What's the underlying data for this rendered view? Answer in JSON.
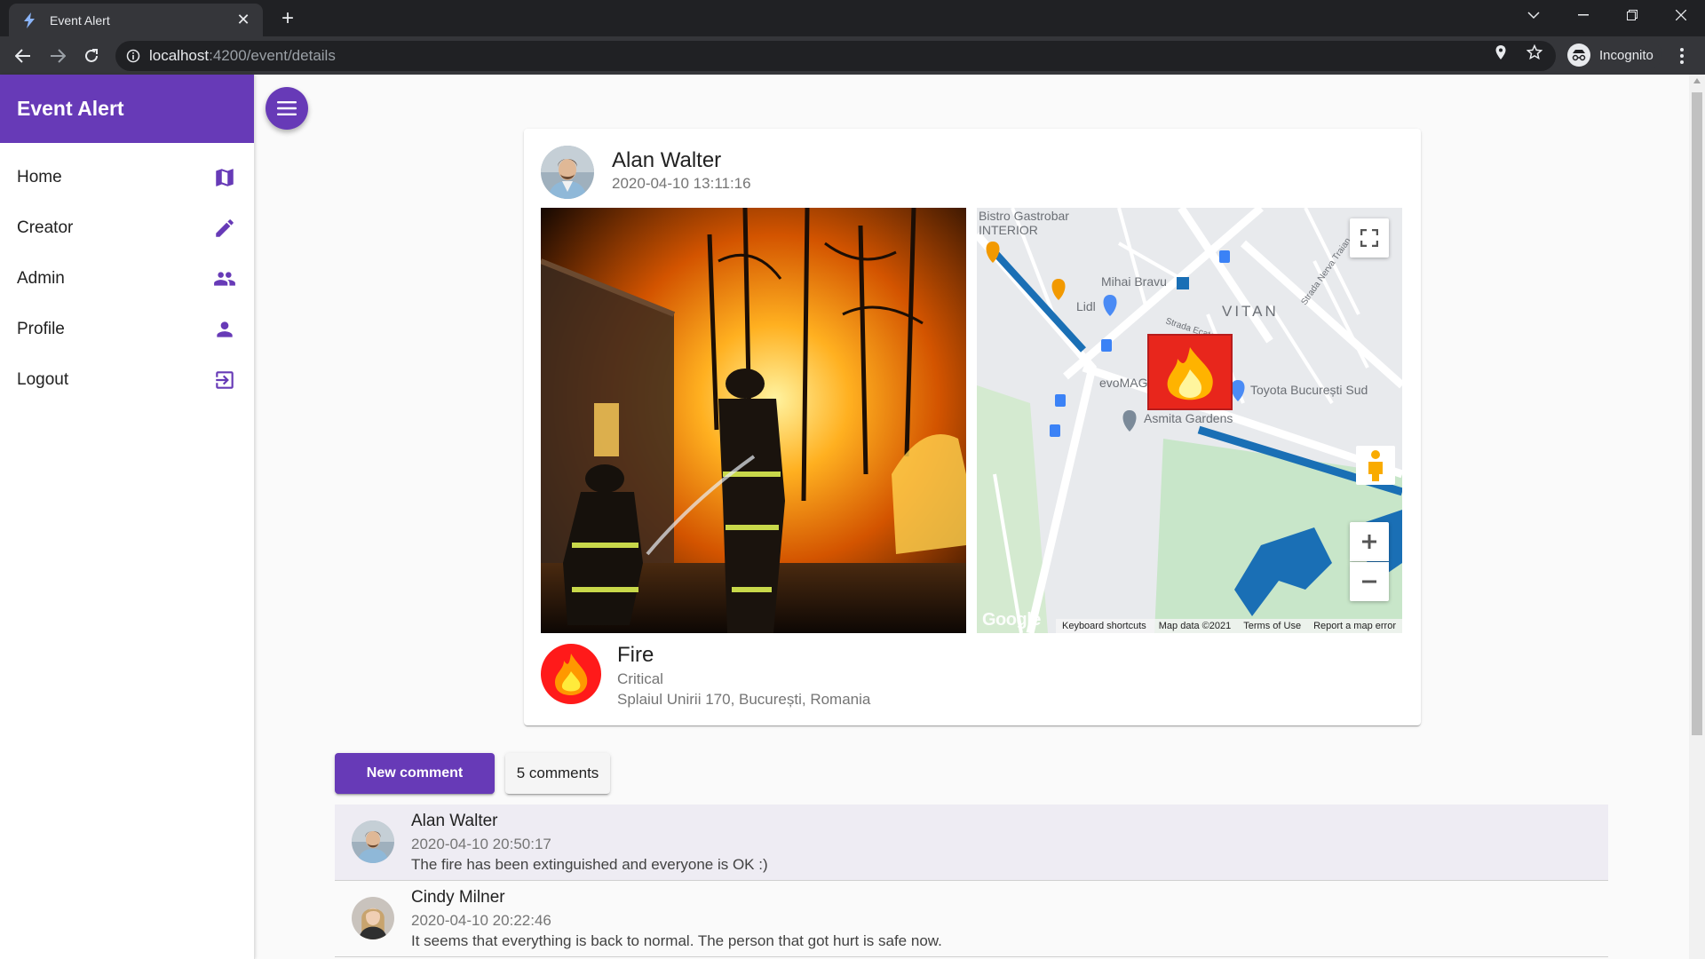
{
  "browser": {
    "tab_title": "Event Alert",
    "url_host": "localhost",
    "url_path": ":4200/event/details",
    "profile_label": "Incognito"
  },
  "sidebar": {
    "title": "Event Alert",
    "items": [
      {
        "label": "Home",
        "icon": "map-icon"
      },
      {
        "label": "Creator",
        "icon": "pencil-icon"
      },
      {
        "label": "Admin",
        "icon": "group-icon"
      },
      {
        "label": "Profile",
        "icon": "person-icon"
      },
      {
        "label": "Logout",
        "icon": "logout-icon"
      }
    ]
  },
  "event": {
    "author": "Alan Walter",
    "posted_at": "2020-04-10 13:11:16",
    "type": "Fire",
    "severity": "Critical",
    "address": "Splaiul Unirii 170, București, Romania"
  },
  "map": {
    "labels": {
      "l1": "Bistro Gastrobar",
      "l2": "INTERIOR",
      "l3": "Mihai Bravu",
      "l4": "Lidl",
      "l5": "VITAN",
      "l6": "evoMAG",
      "l7": "Toyota București Sud",
      "l8": "Asmita Gardens",
      "l9": "Strada Ecaterina",
      "l10": "Strada Nerva Traian"
    },
    "footer": [
      "Keyboard shortcuts",
      "Map data ©2021",
      "Terms of Use",
      "Report a map error"
    ],
    "logo": "Google"
  },
  "actions": {
    "new_comment": "New comment",
    "comments_count": "5 comments"
  },
  "comments": [
    {
      "author": "Alan Walter",
      "date": "2020-04-10 20:50:17",
      "text": "The fire has been extinguished and everyone is OK :)"
    },
    {
      "author": "Cindy Milner",
      "date": "2020-04-10 20:22:46",
      "text": "It seems that everything is back to normal. The person that got hurt is safe now."
    }
  ],
  "colors": {
    "primary": "#673ab7",
    "fire_badge": "#ff1a1a",
    "chrome_dark": "#202124",
    "chrome_toolbar": "#35363a"
  }
}
